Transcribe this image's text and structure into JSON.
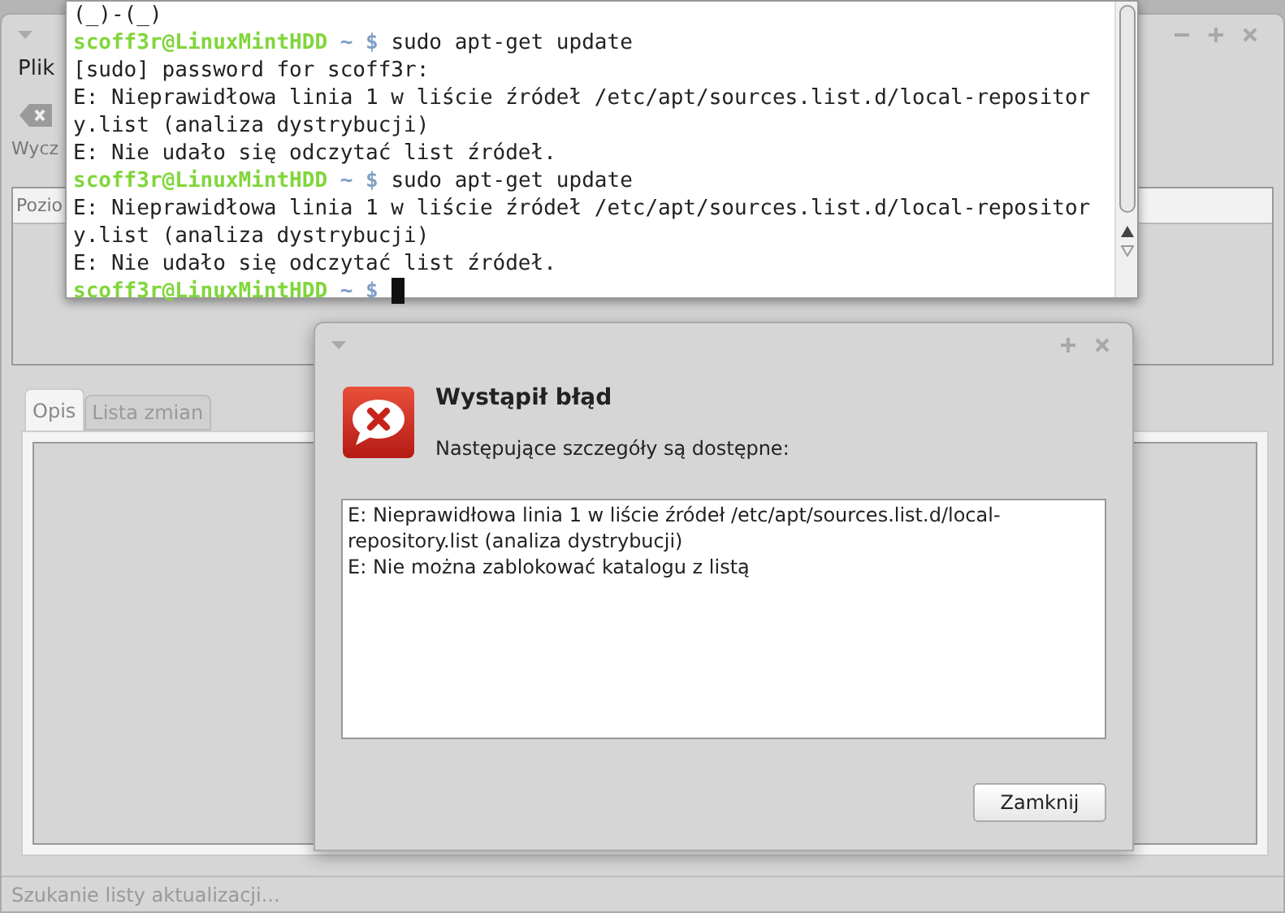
{
  "main_window": {
    "menu": [
      "Plik"
    ],
    "toolbar": [
      {
        "label": "Wycz"
      }
    ],
    "columns": [
      "Pozio"
    ],
    "tabs": [
      {
        "label": "Opis",
        "selected": true
      },
      {
        "label": "Lista zmian",
        "selected": false
      }
    ],
    "status_bar": "Szukanie listy aktualizacji..."
  },
  "terminal": {
    "cursor": true,
    "lines": [
      {
        "kind": "output",
        "text": "(_)-(_)"
      },
      {
        "kind": "prompt",
        "user": "scoff3r@LinuxMintHDD",
        "path": "~ $",
        "command": "sudo apt-get update"
      },
      {
        "kind": "output",
        "text": "[sudo] password for scoff3r:"
      },
      {
        "kind": "output",
        "text": "E: Nieprawidłowa linia 1 w liście źródeł /etc/apt/sources.list.d/local-repositor"
      },
      {
        "kind": "output",
        "text": "y.list (analiza dystrybucji)"
      },
      {
        "kind": "output",
        "text": "E: Nie udało się odczytać list źródeł."
      },
      {
        "kind": "prompt",
        "user": "scoff3r@LinuxMintHDD",
        "path": "~ $",
        "command": "sudo apt-get update"
      },
      {
        "kind": "output",
        "text": "E: Nieprawidłowa linia 1 w liście źródeł /etc/apt/sources.list.d/local-repositor"
      },
      {
        "kind": "output",
        "text": "y.list (analiza dystrybucji)"
      },
      {
        "kind": "output",
        "text": "E: Nie udało się odczytać list źródeł."
      },
      {
        "kind": "prompt",
        "user": "scoff3r@LinuxMintHDD",
        "path": "~ $"
      }
    ]
  },
  "dialog": {
    "title": "Wystąpił błąd",
    "message": "Następujące szczegóły są dostępne:",
    "details": [
      "E: Nieprawidłowa linia 1 w liście źródeł /etc/apt/sources.list.d/local-",
      "repository.list (analiza dystrybucji)",
      "E: Nie można zablokować katalogu z listą"
    ],
    "button": "Zamknij"
  }
}
